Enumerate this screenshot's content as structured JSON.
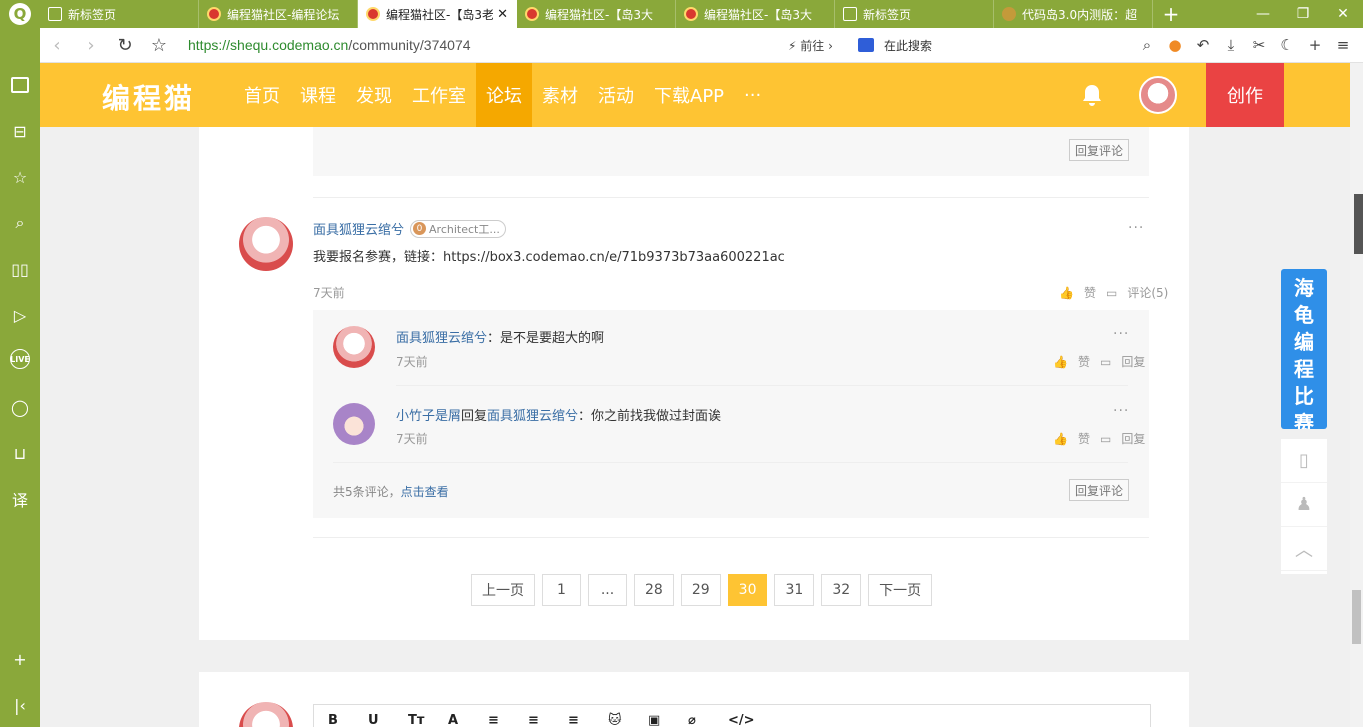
{
  "browser": {
    "tabs": [
      {
        "title": "新标签页",
        "icon": "page"
      },
      {
        "title": "编程猫社区-编程论坛",
        "icon": "cat"
      },
      {
        "title": "编程猫社区-【岛3老",
        "icon": "cat",
        "active": true
      },
      {
        "title": "编程猫社区-【岛3大",
        "icon": "cat"
      },
      {
        "title": "编程猫社区-【岛3大",
        "icon": "cat"
      },
      {
        "title": "新标签页",
        "icon": "page"
      },
      {
        "title": "代码岛3.0内测版：超",
        "icon": "island"
      }
    ],
    "url_scheme": "https://",
    "url_host": "shequ.codemao.cn",
    "url_path": "/community/374074",
    "go_label": "前往",
    "search_placeholder": "在此搜索"
  },
  "header": {
    "logo": "编程猫",
    "nav": [
      "首页",
      "课程",
      "发现",
      "工作室",
      "论坛",
      "素材",
      "活动",
      "下载APP",
      "···"
    ],
    "active_nav": "论坛",
    "create_label": "创作"
  },
  "prev_comment": {
    "reply_label": "回复评论"
  },
  "comment": {
    "user": "面具狐狸云绾兮",
    "badge": "Architect工...",
    "badge_level": "0",
    "text": "我要报名参赛，链接：https://box3.codemao.cn/e/71b9373b73aa600221ac",
    "time": "7天前",
    "like_label": "赞",
    "comment_label": "评论(5)",
    "replies": [
      {
        "user": "面具狐狸云绾兮",
        "reply_word": "",
        "target": "",
        "text": "：是不是要超大的啊",
        "time": "7天前",
        "like": "赞",
        "reply": "回复"
      },
      {
        "user": "小竹子是屑",
        "reply_word": "回复",
        "target": "面具狐狸云绾兮",
        "text": "：你之前找我做过封面诶",
        "time": "7天前",
        "like": "赞",
        "reply": "回复"
      }
    ],
    "total_text": "共5条评论，",
    "view_link": "点击查看",
    "reply_comment_label": "回复评论"
  },
  "pagination": [
    "上一页",
    "1",
    "...",
    "28",
    "29",
    "30",
    "31",
    "32",
    "下一页"
  ],
  "current_page": "30",
  "promo": {
    "text": "海龟编程比赛"
  },
  "editor": {
    "tools": [
      "B",
      "U",
      "Tт",
      "A",
      "≡",
      "≡",
      "≡",
      "🐱",
      "▣",
      "⌀",
      "</>"
    ]
  }
}
